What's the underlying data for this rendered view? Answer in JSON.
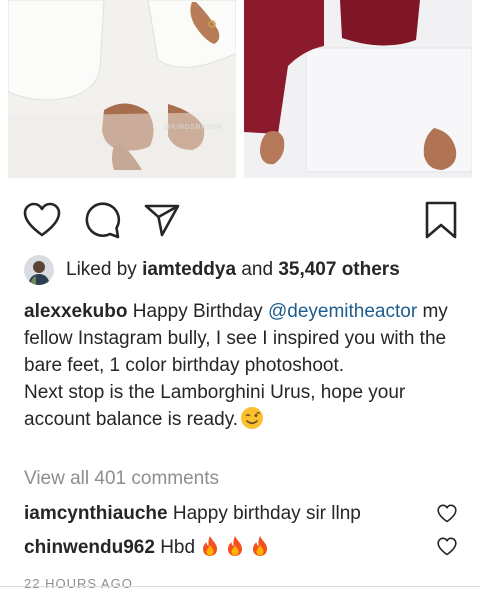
{
  "post": {
    "photos": [
      {
        "name": "left-photo",
        "watermark": "@KINGSRAYUN"
      },
      {
        "name": "right-photo"
      }
    ],
    "actions": {
      "like_icon": "heart-outline-icon",
      "comment_icon": "comment-bubble-icon",
      "share_icon": "paper-plane-icon",
      "save_icon": "bookmark-icon"
    },
    "likes": {
      "prefix": "Liked by",
      "user": "iamteddya",
      "joiner": "and",
      "count": "35,407 others"
    },
    "caption": {
      "author": "alexxekubo",
      "lead": "Happy Birthday",
      "mention": "@deyemitheactor",
      "line1": "my fellow Instagram bully, I see I inspired you with the bare feet, 1 color birthday photoshoot.",
      "line2": "Next stop is the Lamborghini Urus, hope your account balance is ready.",
      "emoji": "wink-emoji"
    },
    "view_all_comments": "View all 401 comments",
    "comments": [
      {
        "user": "iamcynthiauche",
        "text": "Happy birthday sir llnp"
      },
      {
        "user": "chinwendu962",
        "text": "Hbd",
        "emoji": "fire-emoji"
      }
    ],
    "timestamp": "22 HOURS AGO"
  },
  "colors": {
    "text": "#262626",
    "secondary": "#8e8e8e",
    "mention": "#1c5c8e",
    "maroon_outfit": "#8a1a2c"
  }
}
